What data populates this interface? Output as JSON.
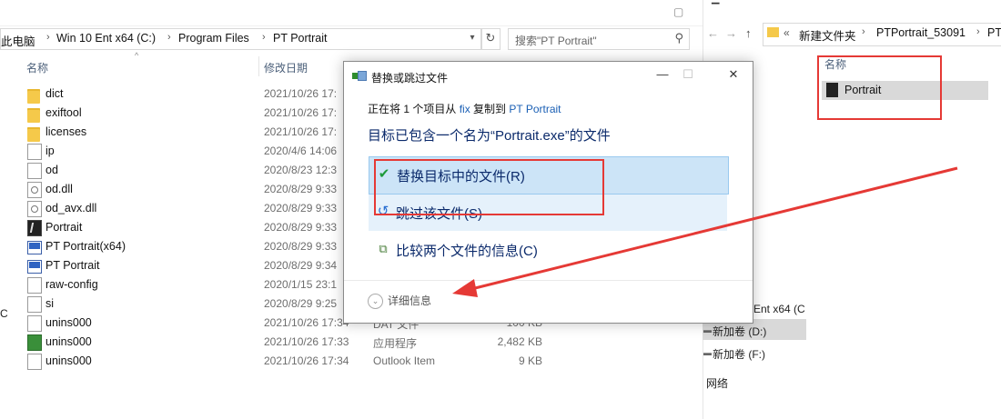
{
  "left_explorer": {
    "breadcrumbs": [
      "此电脑",
      "Win 10 Ent x64 (C:)",
      "Program Files",
      "PT Portrait"
    ],
    "search_placeholder": "搜索\"PT Portrait\"",
    "columns": {
      "name": "名称",
      "date": "修改日期"
    },
    "files": [
      {
        "name": "dict",
        "date": "2021/10/26 17:",
        "type": "",
        "size": "",
        "icon": "folder-icon"
      },
      {
        "name": "exiftool",
        "date": "2021/10/26 17:",
        "type": "",
        "size": "",
        "icon": "folder-icon"
      },
      {
        "name": "licenses",
        "date": "2021/10/26 17:",
        "type": "",
        "size": "",
        "icon": "folder-icon"
      },
      {
        "name": "ip",
        "date": "2020/4/6 14:06",
        "type": "",
        "size": "",
        "icon": "file-icon"
      },
      {
        "name": "od",
        "date": "2020/8/23 12:3",
        "type": "",
        "size": "",
        "icon": "file-icon"
      },
      {
        "name": "od.dll",
        "date": "2020/8/29 9:33",
        "type": "",
        "size": "",
        "icon": "dll-icon"
      },
      {
        "name": "od_avx.dll",
        "date": "2020/8/29 9:33",
        "type": "",
        "size": "",
        "icon": "dll-icon"
      },
      {
        "name": "Portrait",
        "date": "2020/8/29 9:33",
        "type": "",
        "size": "",
        "icon": "portrait-icon"
      },
      {
        "name": "PT Portrait(x64)",
        "date": "2020/8/29 9:33",
        "type": "",
        "size": "",
        "icon": "pt-icon"
      },
      {
        "name": "PT Portrait",
        "date": "2020/8/29 9:34",
        "type": "",
        "size": "",
        "icon": "pt-icon"
      },
      {
        "name": "raw-config",
        "date": "2020/1/15 23:1",
        "type": "",
        "size": "",
        "icon": "file-icon"
      },
      {
        "name": "si",
        "date": "2020/8/29 9:25",
        "type": "",
        "size": "",
        "icon": "file-icon"
      },
      {
        "name": "unins000",
        "date": "2021/10/26 17:34",
        "type": "DAT 文件",
        "size": "100 KB",
        "icon": "file-icon"
      },
      {
        "name": "unins000",
        "date": "2021/10/26 17:33",
        "type": "应用程序",
        "size": "2,482 KB",
        "icon": "unins-icon"
      },
      {
        "name": "unins000",
        "date": "2021/10/26 17:34",
        "type": "Outlook Item",
        "size": "9 KB",
        "icon": "file-icon"
      }
    ]
  },
  "right_explorer": {
    "breadcrumbs": [
      "新建文件夹",
      "PTPortrait_53091",
      "PT"
    ],
    "column_name": "名称",
    "file": "Portrait",
    "sidebar": [
      "Ent x64 (C",
      "新加卷 (D:)",
      "新加卷 (F:)",
      "网络"
    ]
  },
  "dialog": {
    "title": "替换或跳过文件",
    "info_prefix": "正在将 1 个项目从",
    "info_source": "fix",
    "info_middle": "复制到",
    "info_dest": "PT Portrait",
    "message": "目标已包含一个名为“Portrait.exe”的文件",
    "options": {
      "replace": "替换目标中的文件(R)",
      "skip": "跳过该文件(S)",
      "compare": "比较两个文件的信息(C)"
    },
    "details": "详细信息"
  },
  "colors": {
    "annotation_red": "#e53935",
    "selection_blue": "#cce4f7",
    "link_blue": "#1a5fb4"
  }
}
